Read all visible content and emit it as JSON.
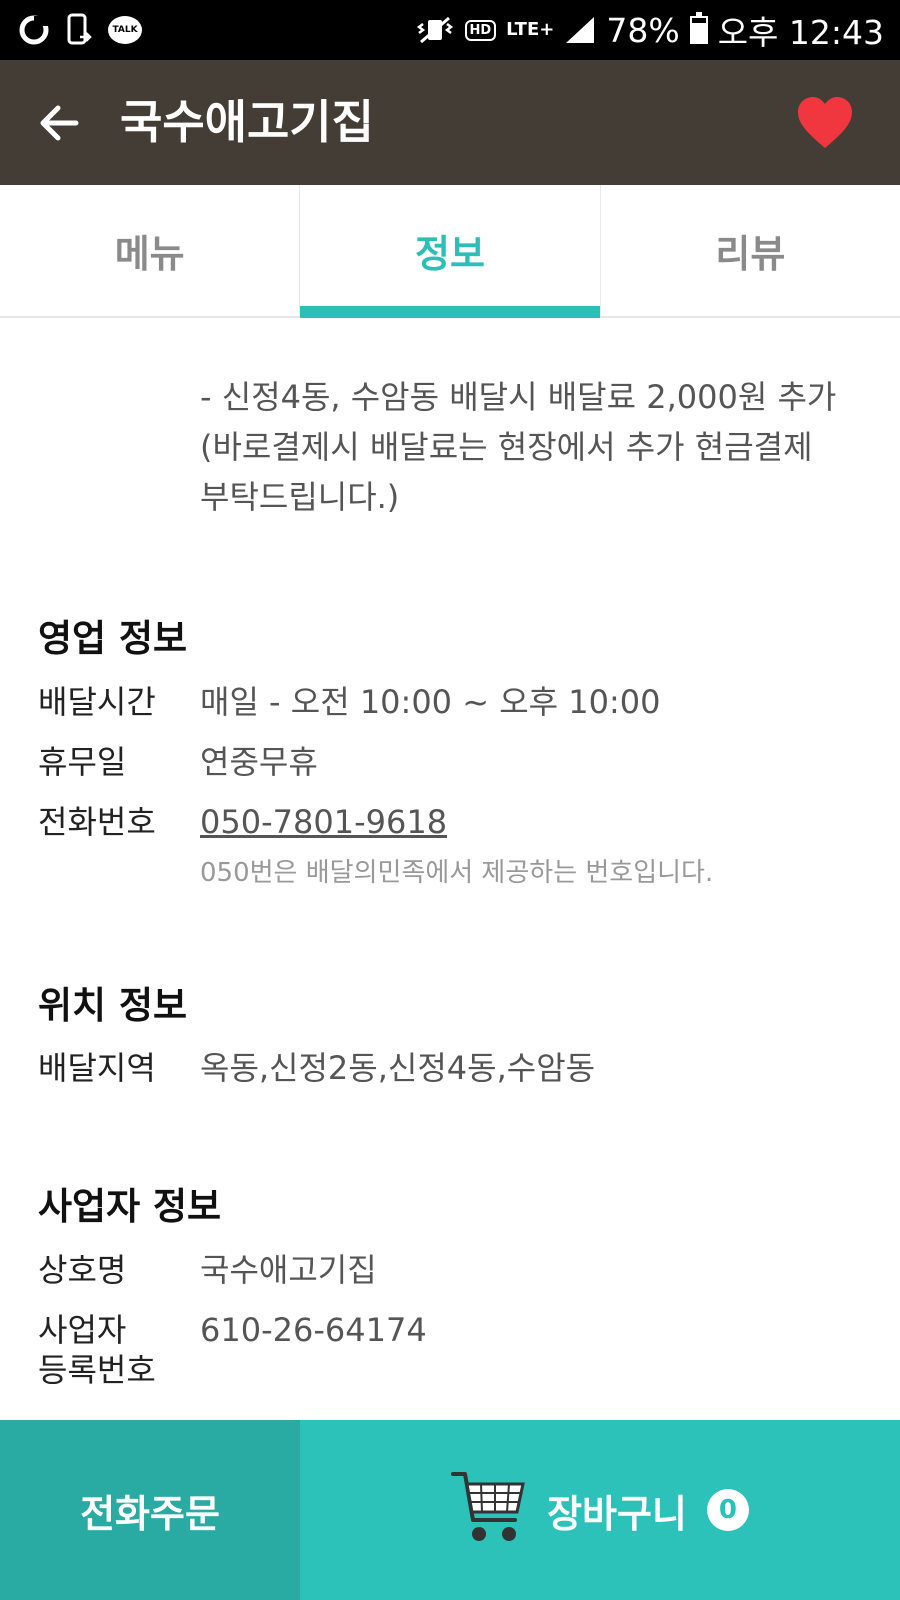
{
  "status_bar": {
    "talk_label": "TALK",
    "hd_label": "HD",
    "network_label": "LTE+",
    "battery_percent": "78%",
    "battery_level": 0.78,
    "time": "오후 12:43"
  },
  "header": {
    "title": "국수애고기집",
    "heart_color": "#f0373f",
    "background": "#443d36"
  },
  "tabs": [
    {
      "label": "메뉴",
      "active": false
    },
    {
      "label": "정보",
      "active": true
    },
    {
      "label": "리뷰",
      "active": false
    }
  ],
  "accent_color": "#2cbfb7",
  "notice": {
    "line1": "- 신정4동, 수암동 배달시 배달료 2,000원 추가",
    "line2": "(바로결제시 배달료는 현장에서 추가 현금결제",
    "line3": "부탁드립니다.)"
  },
  "business_hours": {
    "title": "영업 정보",
    "delivery_time_label": "배달시간",
    "delivery_time_value": "매일 - 오전 10:00 ~ 오후 10:00",
    "holiday_label": "휴무일",
    "holiday_value": "연중무휴",
    "phone_label": "전화번호",
    "phone_value": "050-7801-9618",
    "phone_note": "050번은 배달의민족에서 제공하는 번호입니다."
  },
  "location": {
    "title": "위치 정보",
    "area_label": "배달지역",
    "area_value": "옥동,신정2동,신정4동,수암동"
  },
  "business": {
    "title": "사업자 정보",
    "name_label": "상호명",
    "name_value": "국수애고기집",
    "reg_label_line1": "사업자",
    "reg_label_line2": "등록번호",
    "reg_value": "610-26-64174"
  },
  "bottom_bar": {
    "phone_order_label": "전화주문",
    "cart_label": "장바구니",
    "cart_count": "0"
  }
}
